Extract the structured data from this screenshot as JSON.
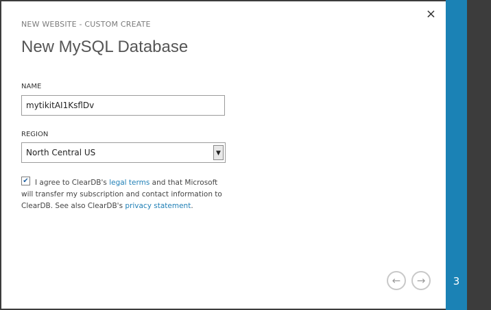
{
  "dialog": {
    "wizard_title": "NEW WEBSITE - CUSTOM CREATE",
    "page_title": "New MySQL Database",
    "close_icon": "close-icon",
    "close_glyph": "×"
  },
  "form": {
    "name_label": "NAME",
    "name_value": "mytikitAI1KsflDv",
    "region_label": "REGION",
    "region_value": "North Central US",
    "agree_checked": true,
    "agree_text_1": "I agree to ClearDB's ",
    "legal_terms_link": "legal terms",
    "agree_text_2": " and that Microsoft will transfer my subscription and contact information to ClearDB. See also ClearDB's ",
    "privacy_link": "privacy statement",
    "agree_text_3": "."
  },
  "navigation": {
    "back_icon": "arrow-left-icon",
    "next_icon": "arrow-right-icon",
    "back_glyph": "←",
    "next_glyph": "→",
    "step_number": "3"
  },
  "colors": {
    "accent": "#1b82b5",
    "link": "#1f7fb6",
    "background": "#3c3c3c"
  }
}
